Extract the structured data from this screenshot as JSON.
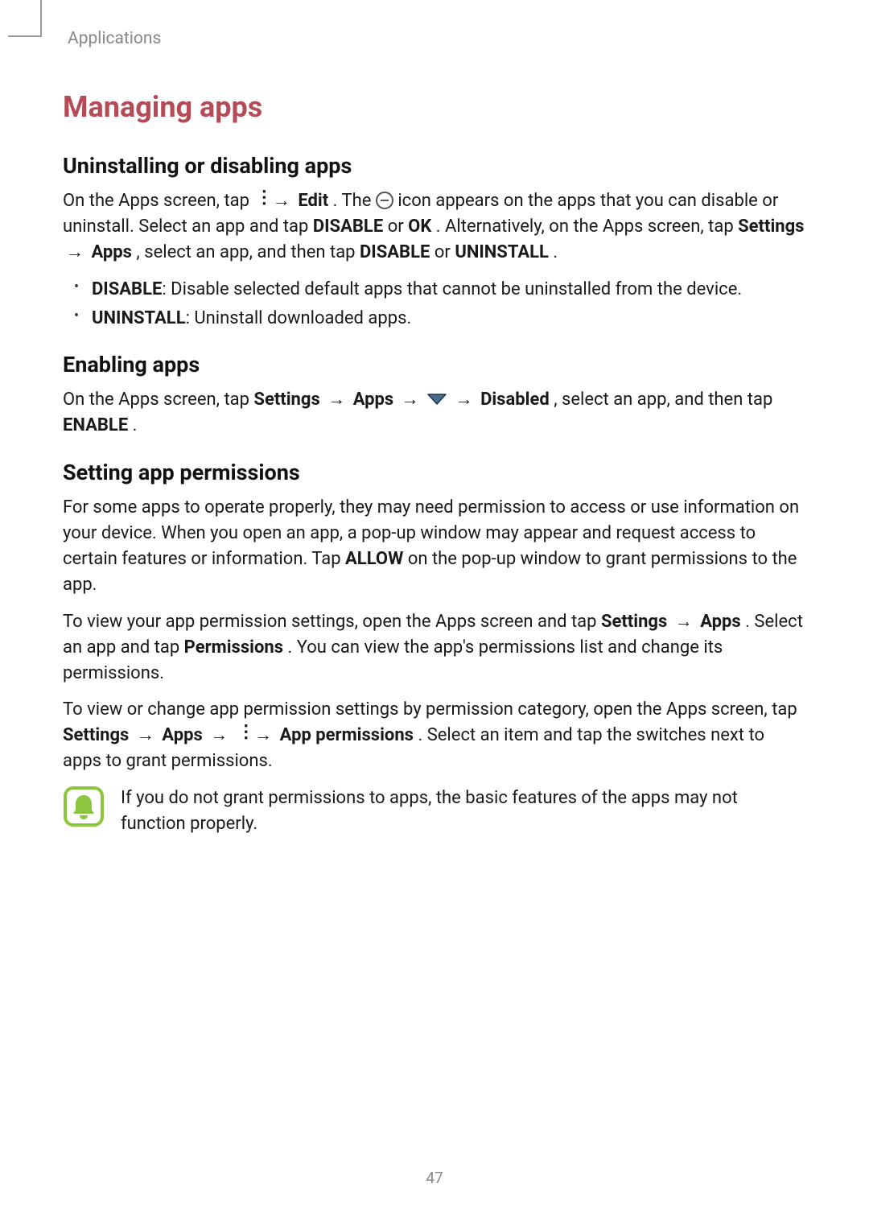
{
  "header": {
    "section": "Applications"
  },
  "title": "Managing apps",
  "sections": {
    "uninstall": {
      "heading": "Uninstalling or disabling apps",
      "p1a": "On the Apps screen, tap ",
      "p1b": " → ",
      "edit": "Edit",
      "p1c": ". The ",
      "p1d": " icon appears on the apps that you can disable or uninstall. Select an app and tap ",
      "disable1": "DISABLE",
      "or1": " or ",
      "ok": "OK",
      "p1e": ". Alternatively, on the Apps screen, tap ",
      "settings": "Settings",
      "arr": " → ",
      "apps": "Apps",
      "p1f": ", select an app, and then tap ",
      "disable2": "DISABLE",
      "or2": " or ",
      "uninstall": "UNINSTALL",
      "p1g": ".",
      "bullets": {
        "b1a": "DISABLE",
        "b1b": ": Disable selected default apps that cannot be uninstalled from the device.",
        "b2a": "UNINSTALL",
        "b2b": ": Uninstall downloaded apps."
      }
    },
    "enable": {
      "heading": "Enabling apps",
      "p1a": "On the Apps screen, tap ",
      "settings": "Settings",
      "arr1": " → ",
      "apps": "Apps",
      "arr2": " → ",
      "arr3": " → ",
      "disabled": "Disabled",
      "p1b": ", select an app, and then tap ",
      "enable": "ENABLE",
      "p1c": "."
    },
    "perms": {
      "heading": "Setting app permissions",
      "p1": "For some apps to operate properly, they may need permission to access or use information on your device. When you open an app, a pop-up window may appear and request access to certain features or information. Tap ",
      "allow": "ALLOW",
      "p1b": " on the pop-up window to grant permissions to the app.",
      "p2a": "To view your app permission settings, open the Apps screen and tap ",
      "settings": "Settings",
      "arr1": " → ",
      "apps": "Apps",
      "p2b": ". Select an app and tap ",
      "permissions": "Permissions",
      "p2c": ". You can view the app's permissions list and change its permissions.",
      "p3a": "To view or change app permission settings by permission category, open the Apps screen, tap ",
      "settings2": "Settings",
      "arr2": " → ",
      "apps2": "Apps",
      "arr3": " → ",
      "arr4": " → ",
      "appperm": "App permissions",
      "p3b": ". Select an item and tap the switches next to apps to grant permissions."
    }
  },
  "note": "If you do not grant permissions to apps, the basic features of the apps may not function properly.",
  "page_number": "47"
}
